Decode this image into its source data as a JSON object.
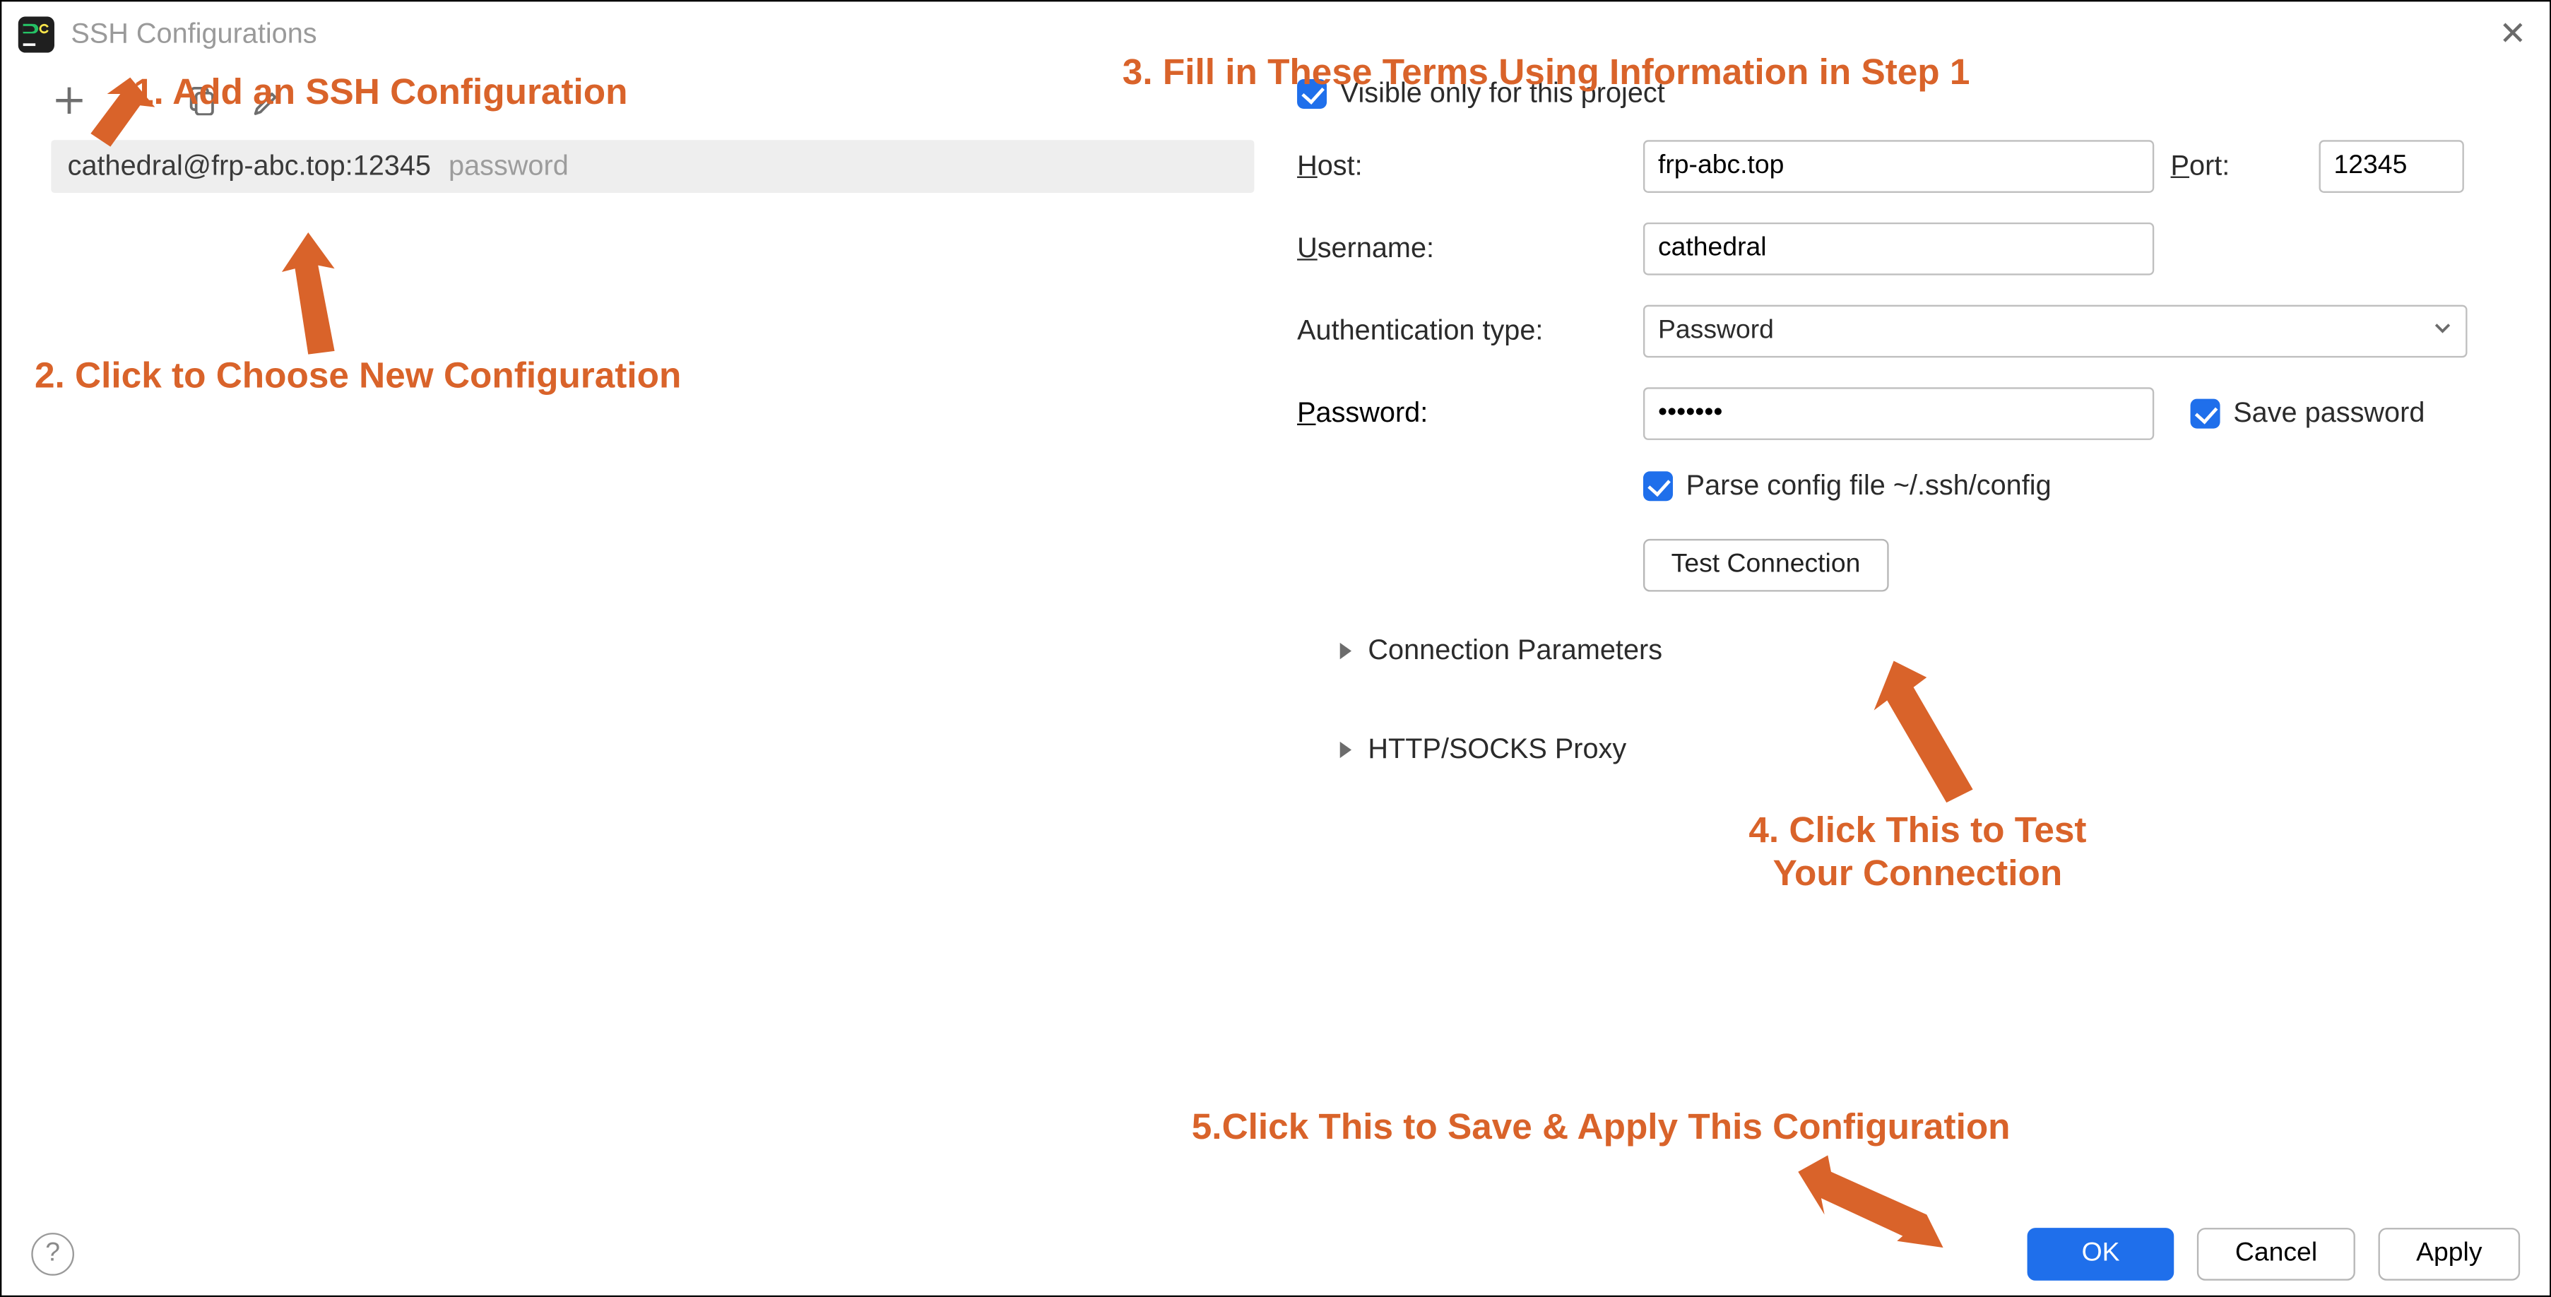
{
  "window": {
    "title": "SSH Configurations"
  },
  "left": {
    "config_item_name": "cathedral@frp-abc.top:12345",
    "config_item_auth_tag": "password"
  },
  "form": {
    "visible_only_label": "Visible only for this project",
    "host_label_pre": "H",
    "host_label_rest": "ost:",
    "host_value": "frp-abc.top",
    "port_label_pre": "P",
    "port_label_rest": "ort:",
    "port_value": "12345",
    "username_label_pre": "U",
    "username_label_rest": "sername:",
    "username_value": "cathedral",
    "auth_type_label": "Authentication type:",
    "auth_type_value": "Password",
    "password_label_pre": "P",
    "password_label_rest": "assword:",
    "password_value": "•••••••",
    "save_password_label": "Save password",
    "parse_config_label": "Parse config file ~/.ssh/config",
    "test_connection_label": "Test Connection",
    "conn_params_label": "Connection Parameters",
    "proxy_label": "HTTP/SOCKS Proxy"
  },
  "footer": {
    "ok": "OK",
    "cancel": "Cancel",
    "apply": "Apply"
  },
  "annotations": {
    "a1": "1. Add an SSH Configuration",
    "a2": "2. Click to Choose New Configuration",
    "a3": "3. Fill in These Terms Using Information in Step 1",
    "a4_line1": "4. Click This to Test",
    "a4_line2": "Your Connection",
    "a5": "5.Click This to Save & Apply This Configuration"
  }
}
